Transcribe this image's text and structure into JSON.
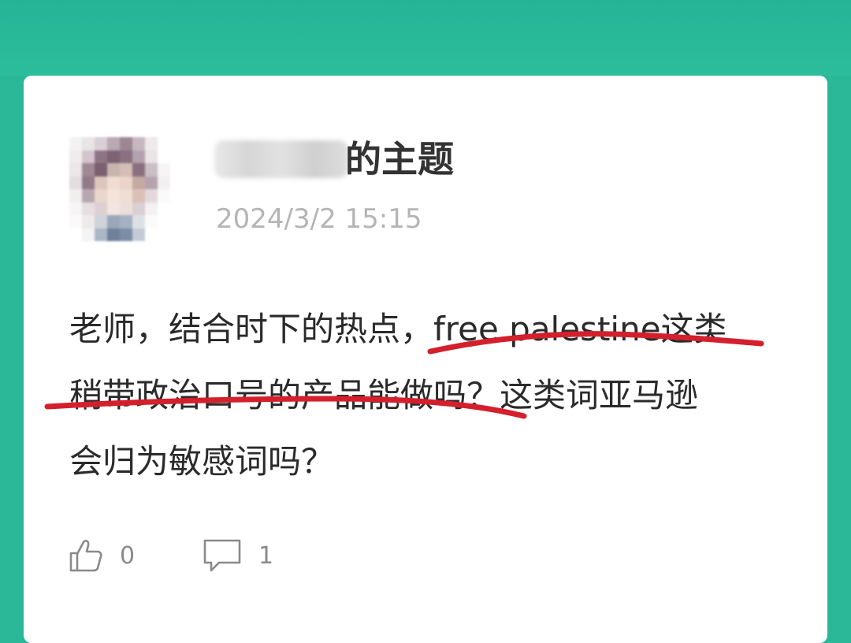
{
  "post": {
    "title_suffix": "的主题",
    "timestamp": "2024/3/2 15:15",
    "body_lines": [
      "老师，结合时下的热点，free  palestine这类",
      "稍带政治口号的产品能做吗？这类词亚马逊",
      "会归为敏感词吗？"
    ]
  },
  "actions": {
    "like_icon": "thumbs-up-icon",
    "like_count": "0",
    "comment_icon": "comment-bubble-icon",
    "comment_count": "1"
  },
  "colors": {
    "background": "#2bb898",
    "card": "#ffffff",
    "underline": "#d4202c",
    "timestamp": "#b5b5b5",
    "body_text": "#2a2a2a"
  }
}
